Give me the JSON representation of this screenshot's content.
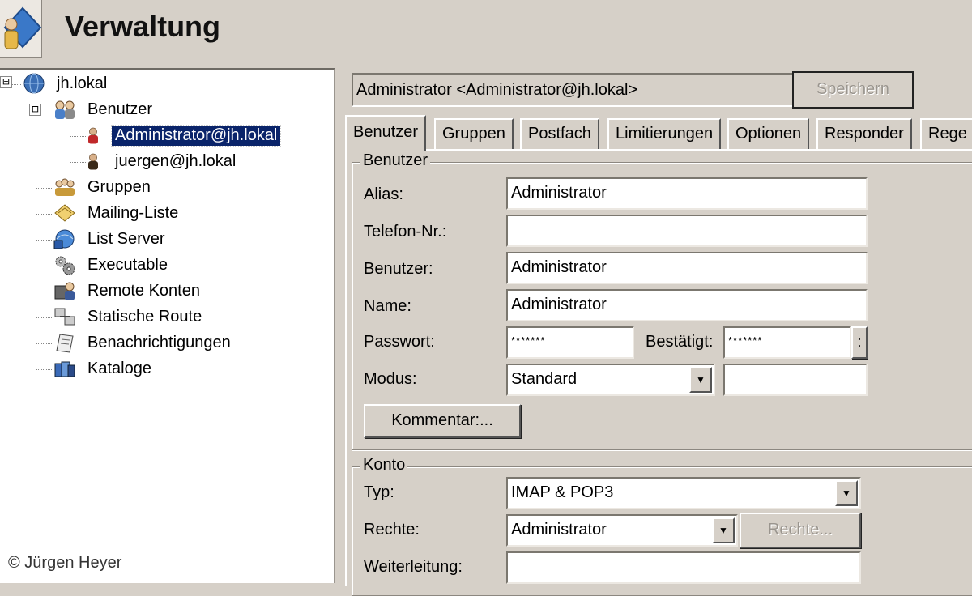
{
  "header": {
    "title": "Verwaltung"
  },
  "tree": {
    "root": "jh.lokal",
    "items": {
      "benutzer": "Benutzer",
      "user_admin": "Administrator@jh.lokal",
      "user_juergen": "juergen@jh.lokal",
      "gruppen": "Gruppen",
      "mailing_liste": "Mailing-Liste",
      "list_server": "List Server",
      "executable": "Executable",
      "remote_konten": "Remote Konten",
      "statische_route": "Statische Route",
      "benachrichtigungen": "Benachrichtigungen",
      "kataloge": "Kataloge"
    },
    "selected": "Administrator@jh.lokal",
    "expander_symbol": "⊟"
  },
  "top": {
    "current_user": "Administrator <Administrator@jh.lokal>",
    "save_label": "Speichern"
  },
  "tabs": [
    "Benutzer",
    "Gruppen",
    "Postfach",
    "Limitierungen",
    "Optionen",
    "Responder",
    "Rege"
  ],
  "benutzer_group": {
    "title": "Benutzer",
    "alias_label": "Alias:",
    "alias_value": "Administrator",
    "telefon_label": "Telefon-Nr.:",
    "telefon_value": "",
    "benutzer_label": "Benutzer:",
    "benutzer_value": "Administrator",
    "name_label": "Name:",
    "name_value": "Administrator",
    "passwort_label": "Passwort:",
    "passwort_value": "*******",
    "bestaetigt_label": "Bestätigt:",
    "bestaetigt_value": "*******",
    "dots_button": ":",
    "modus_label": "Modus:",
    "modus_value": "Standard",
    "modus_extra_value": "",
    "kommentar_button": "Kommentar:..."
  },
  "konto_group": {
    "title": "Konto",
    "typ_label": "Typ:",
    "typ_value": "IMAP & POP3",
    "rechte_label": "Rechte:",
    "rechte_value": "Administrator",
    "rechte_button": "Rechte...",
    "weiterleitung_label": "Weiterleitung:",
    "weiterleitung_value": ""
  },
  "copyright": "© Jürgen Heyer"
}
